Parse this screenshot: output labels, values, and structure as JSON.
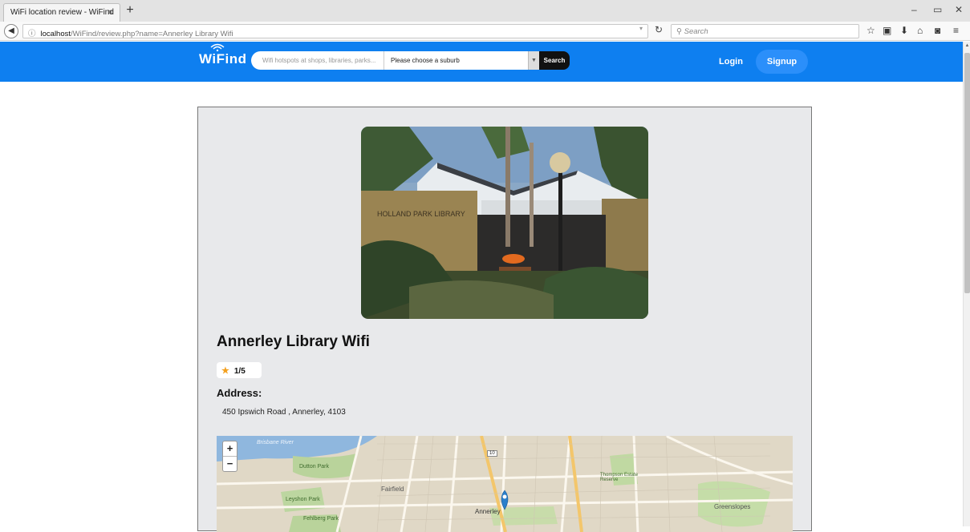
{
  "browser": {
    "tab_title": "WiFi location review - WiFind",
    "tab_close": "×",
    "new_tab": "+",
    "url_host": "localhost",
    "url_path": "/WiFind/review.php?name=Annerley Library Wifi",
    "search_placeholder": "Search",
    "icons": [
      "back-arrow-icon",
      "info-icon",
      "reload-icon",
      "search-icon",
      "bookmark-star-icon",
      "reading-list-icon",
      "download-icon",
      "home-icon",
      "pocket-icon",
      "menu-icon"
    ]
  },
  "header": {
    "logo_text": "WiFind",
    "search_placeholder": "Wifi hotspots at shops, libraries, parks...",
    "suburb_selected": "Please choose a suburb",
    "search_button": "Search",
    "login_label": "Login",
    "signup_label": "Signup",
    "brand_color": "#0e7ff0"
  },
  "place": {
    "title": "Annerley Library Wifi",
    "rating": "1/5",
    "address_label": "Address:",
    "address": "450 Ipswich Road , Annerley, 4103",
    "photo_sign_text": "HOLLAND PARK LIBRARY"
  },
  "map": {
    "zoom_in": "+",
    "zoom_out": "−",
    "labels": {
      "river": "Brisbane River",
      "park1": "Dutton Park",
      "park2": "Fehlberg Park",
      "park3": "Leyshon Park",
      "fairfield": "Fairfield",
      "annerley": "Annerley",
      "greenslopes": "Greenslopes",
      "thompson": "Thompson Estate Reserve",
      "route": "10"
    }
  }
}
